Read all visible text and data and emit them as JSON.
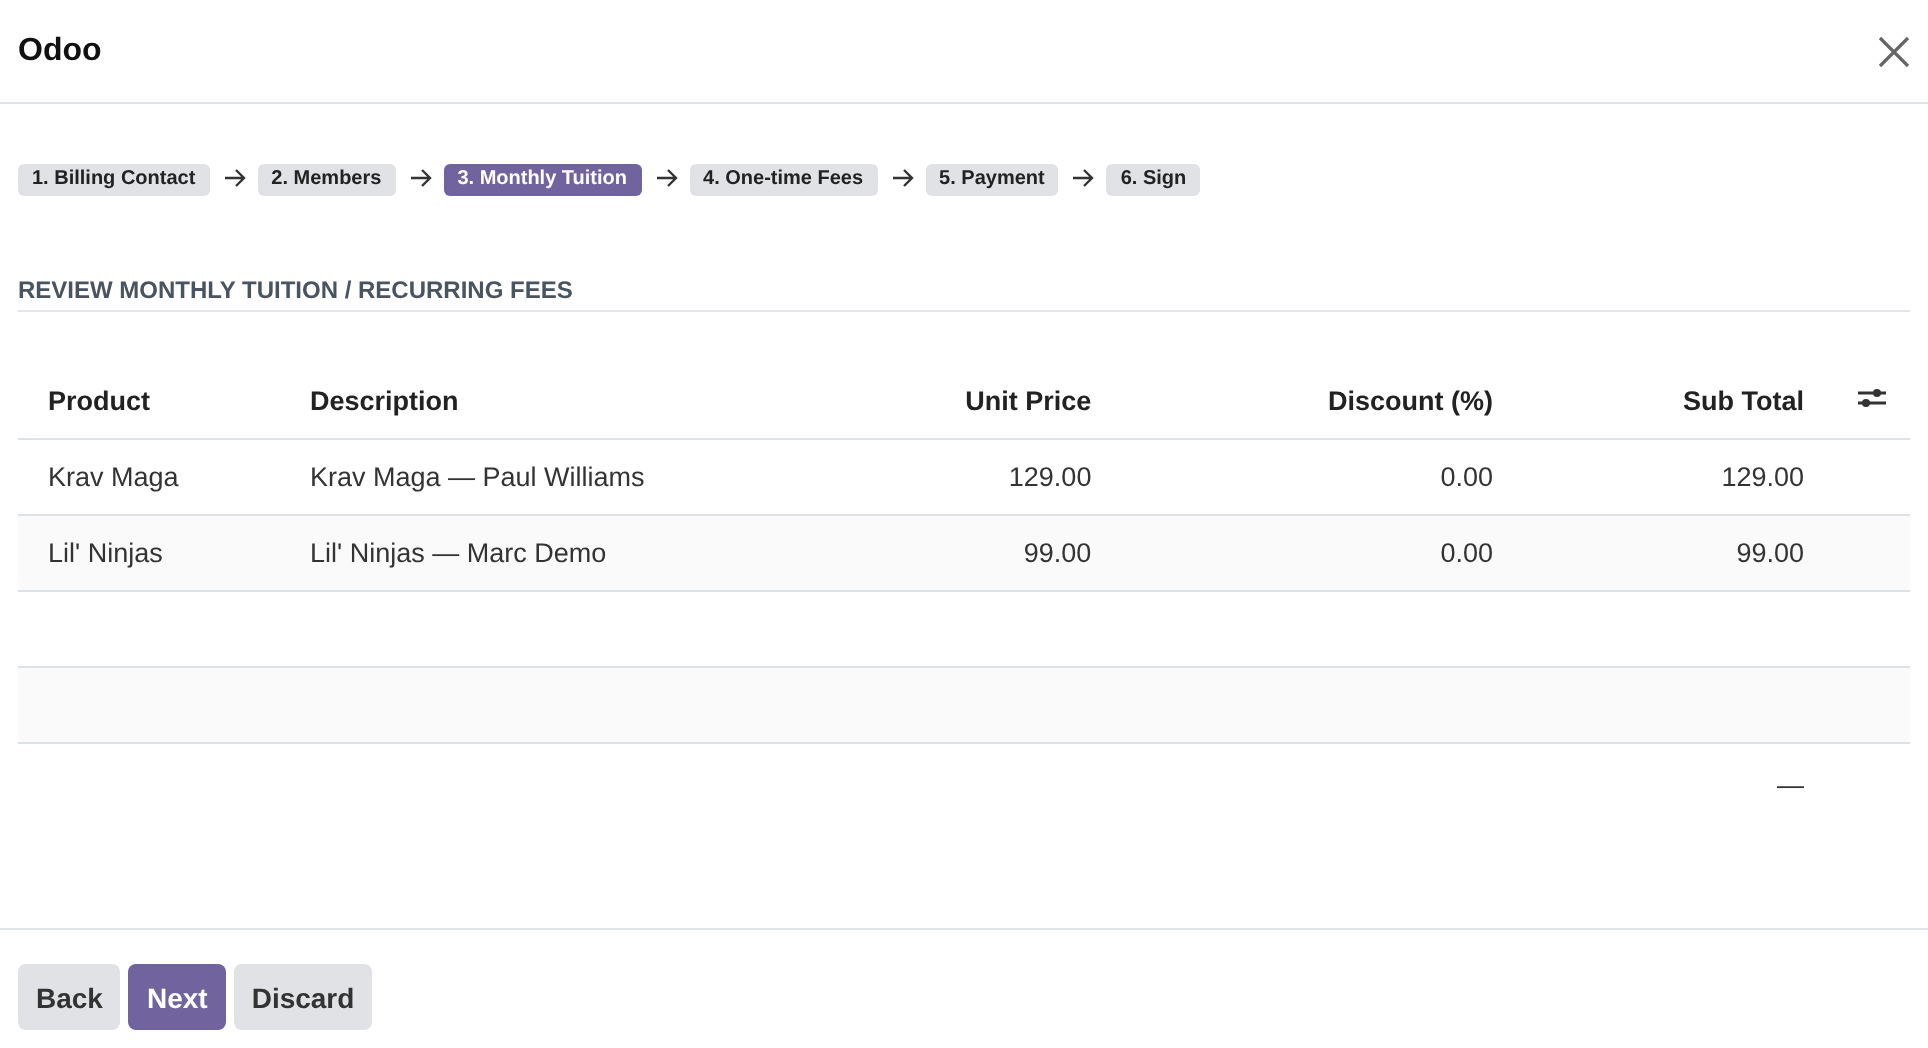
{
  "window": {
    "title": "Odoo"
  },
  "steps": [
    {
      "label": "1. Billing Contact",
      "selected": false
    },
    {
      "label": "2. Members",
      "selected": false
    },
    {
      "label": "3. Monthly Tuition",
      "selected": true
    },
    {
      "label": "4. One-time Fees",
      "selected": false
    },
    {
      "label": "5. Payment",
      "selected": false
    },
    {
      "label": "6. Sign",
      "selected": false
    }
  ],
  "section_title": "REVIEW MONTHLY TUITION / RECURRING FEES",
  "table": {
    "columns": [
      {
        "label": "Product",
        "kind": "text"
      },
      {
        "label": "Description",
        "kind": "text"
      },
      {
        "label": "Unit Price",
        "kind": "number"
      },
      {
        "label": "Discount (%)",
        "kind": "number"
      },
      {
        "label": "Sub Total",
        "kind": "number"
      }
    ],
    "rows": [
      [
        "Krav Maga",
        "Krav Maga — Paul Williams",
        "129.00",
        "0.00",
        "129.00"
      ],
      [
        "Lil' Ninjas",
        "Lil' Ninjas — Marc Demo",
        "99.00",
        "0.00",
        "99.00"
      ]
    ],
    "footer_total": "—"
  },
  "buttons": [
    {
      "label": "Back",
      "kind": "secondary"
    },
    {
      "label": "Next",
      "kind": "primary"
    },
    {
      "label": "Discard",
      "kind": "secondary"
    }
  ]
}
